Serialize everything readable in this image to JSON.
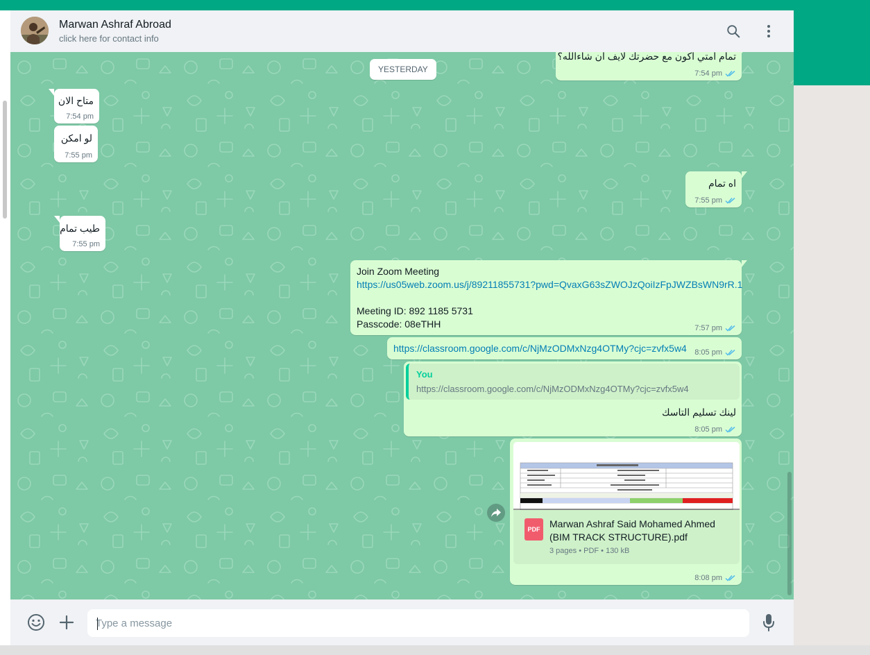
{
  "header": {
    "contact_name": "Marwan Ashraf Abroad",
    "contact_subtitle": "click here for contact info",
    "search_icon": "search-icon",
    "menu_icon": "kebab-menu-icon"
  },
  "colors": {
    "accent": "#00a884",
    "chat_background": "#7ec9a6",
    "outgoing_bubble": "#d9fdd3",
    "incoming_bubble": "#ffffff",
    "link": "#027eb5",
    "read_tick": "#53bdeb",
    "quote_bar": "#06cf9c",
    "pdf_icon": "#f15c6d"
  },
  "date_divider": "YESTERDAY",
  "messages": [
    {
      "dir": "out",
      "text": "تمام امتي اكون مع حضرتك لايف ان شاءالله؟",
      "time": "7:54 pm",
      "status": "read"
    },
    {
      "dir": "in",
      "text": "متاح الان",
      "time": "7:54 pm"
    },
    {
      "dir": "in",
      "text": "لو امكن",
      "time": "7:55 pm"
    },
    {
      "dir": "out",
      "text": "اه تمام",
      "time": "7:55 pm",
      "status": "read"
    },
    {
      "dir": "in",
      "text": "طيب تمام",
      "time": "7:55 pm"
    },
    {
      "dir": "out",
      "lines": [
        "Join Zoom Meeting",
        "https://us05web.zoom.us/j/89211855731?pwd=QvaxG63sZWOJzQoiIzFpJWZBsWN9rR.1",
        "",
        "Meeting ID: 892 1185 5731",
        "Passcode: 08eTHH"
      ],
      "time": "7:57 pm",
      "status": "read"
    },
    {
      "dir": "out",
      "text": "https://classroom.google.com/c/NjMzODMxNzg4OTMy?cjc=zvfx5w4",
      "time": "8:05 pm",
      "status": "read"
    },
    {
      "dir": "out",
      "quote": {
        "author": "You",
        "text": "https://classroom.google.com/c/NjMzODMxNzg4OTMy?cjc=zvfx5w4"
      },
      "text": "لينك تسليم التاسك",
      "time": "8:05 pm",
      "status": "read"
    },
    {
      "dir": "out",
      "document": {
        "name_line1": "Marwan Ashraf Said Mohamed Ahmed",
        "name_line2": "(BIM TRACK STRUCTURE).pdf",
        "type_label": "PDF",
        "meta": "3 pages • PDF • 130 kB"
      },
      "time": "8:08 pm",
      "status": "read"
    }
  ],
  "footer": {
    "emoji_icon": "emoji-icon",
    "attach_icon": "plus-icon",
    "input_placeholder": "Type a message",
    "input_value": "",
    "mic_icon": "microphone-icon"
  }
}
